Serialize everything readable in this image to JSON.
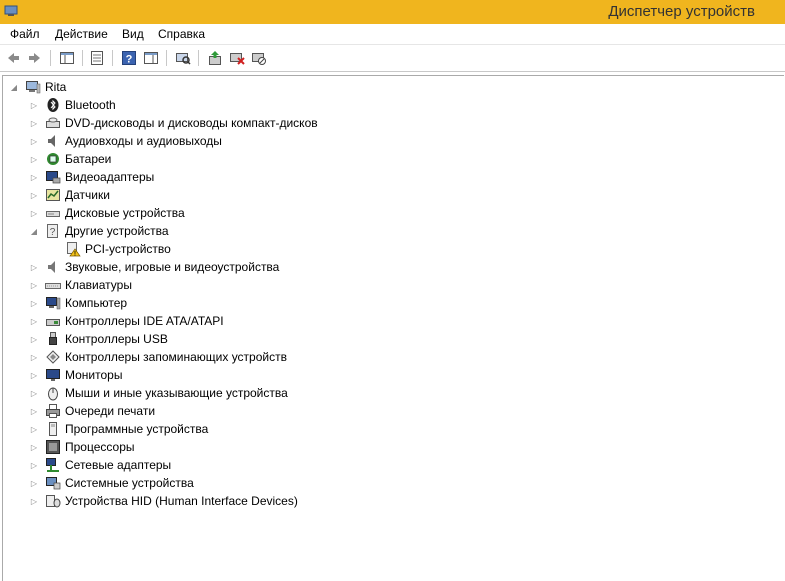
{
  "window": {
    "title": "Диспетчер устройств"
  },
  "menu": {
    "file": "Файл",
    "action": "Действие",
    "view": "Вид",
    "help": "Справка"
  },
  "toolbar": {
    "buttons": [
      "back-icon",
      "forward-icon",
      "console-tree-icon",
      "properties-icon",
      "help-icon",
      "action-pane-icon",
      "scan-hardware-icon",
      "update-driver-icon",
      "uninstall-icon",
      "disable-icon"
    ]
  },
  "tree": {
    "root": "Rita",
    "items": [
      {
        "label": "Bluetooth",
        "icon": "bluetooth-icon"
      },
      {
        "label": "DVD-дисководы и дисководы компакт-дисков",
        "icon": "dvd-drive-icon"
      },
      {
        "label": "Аудиовходы и аудиовыходы",
        "icon": "audio-io-icon"
      },
      {
        "label": "Батареи",
        "icon": "battery-icon"
      },
      {
        "label": "Видеоадаптеры",
        "icon": "display-adapter-icon"
      },
      {
        "label": "Датчики",
        "icon": "sensor-icon"
      },
      {
        "label": "Дисковые устройства",
        "icon": "disk-drive-icon"
      },
      {
        "label": "Другие устройства",
        "icon": "other-devices-icon",
        "expanded": true
      },
      {
        "label": "PCI-устройство",
        "icon": "warning-device-icon",
        "child": true
      },
      {
        "label": "Звуковые, игровые и видеоустройства",
        "icon": "sound-icon"
      },
      {
        "label": "Клавиатуры",
        "icon": "keyboard-icon"
      },
      {
        "label": "Компьютер",
        "icon": "computer-icon"
      },
      {
        "label": "Контроллеры IDE ATA/ATAPI",
        "icon": "ide-controller-icon"
      },
      {
        "label": "Контроллеры USB",
        "icon": "usb-icon"
      },
      {
        "label": "Контроллеры запоминающих устройств",
        "icon": "storage-controller-icon"
      },
      {
        "label": "Мониторы",
        "icon": "monitor-icon"
      },
      {
        "label": "Мыши и иные указывающие устройства",
        "icon": "mouse-icon"
      },
      {
        "label": "Очереди печати",
        "icon": "printer-icon"
      },
      {
        "label": "Программные устройства",
        "icon": "software-device-icon"
      },
      {
        "label": "Процессоры",
        "icon": "processor-icon"
      },
      {
        "label": "Сетевые адаптеры",
        "icon": "network-adapter-icon"
      },
      {
        "label": "Системные устройства",
        "icon": "system-devices-icon"
      },
      {
        "label": "Устройства HID (Human Interface Devices)",
        "icon": "hid-icon"
      }
    ]
  }
}
